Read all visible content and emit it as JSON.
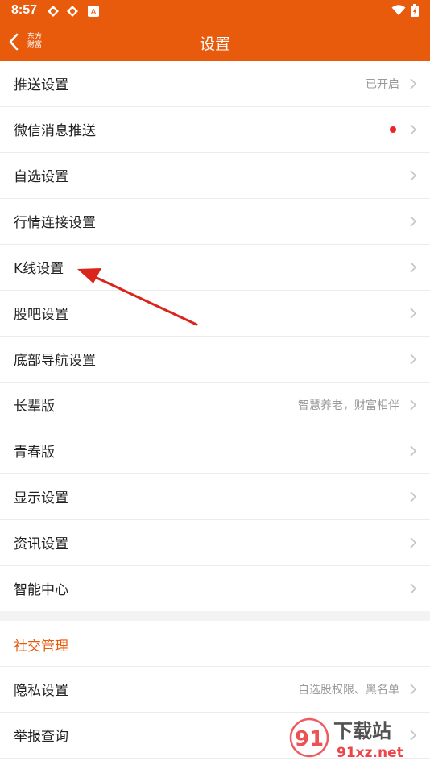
{
  "status": {
    "time": "8:57"
  },
  "header": {
    "title": "设置",
    "logo_line1": "东方",
    "logo_line2": "财富"
  },
  "rows": [
    {
      "label": "推送设置",
      "value": "已开启"
    },
    {
      "label": "微信消息推送",
      "value": ""
    },
    {
      "label": "自选设置",
      "value": ""
    },
    {
      "label": "行情连接设置",
      "value": ""
    },
    {
      "label": "K线设置",
      "value": ""
    },
    {
      "label": "股吧设置",
      "value": ""
    },
    {
      "label": "底部导航设置",
      "value": ""
    },
    {
      "label": "长辈版",
      "value": "智慧养老，财富相伴"
    },
    {
      "label": "青春版",
      "value": ""
    },
    {
      "label": "显示设置",
      "value": ""
    },
    {
      "label": "资讯设置",
      "value": ""
    },
    {
      "label": "智能中心",
      "value": ""
    }
  ],
  "social": {
    "section_title": "社交管理",
    "rows": [
      {
        "label": "隐私设置",
        "value": "自选股权限、黑名单"
      },
      {
        "label": "举报查询",
        "value": ""
      }
    ]
  },
  "watermark": {
    "brand": "下载站",
    "url": "91xz.net",
    "logo": "91"
  },
  "colors": {
    "accent": "#e85a0c",
    "badge": "#e8262a",
    "annotation_arrow": "#d9261c"
  }
}
